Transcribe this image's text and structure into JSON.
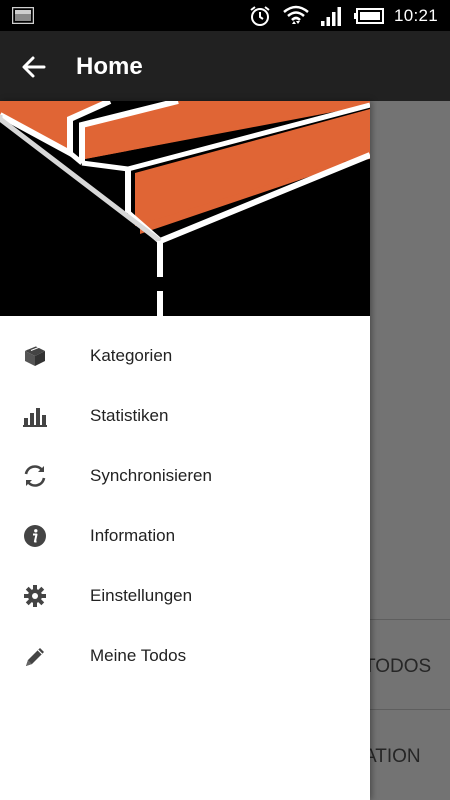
{
  "status_bar": {
    "time": "10:21",
    "icons": [
      "screenshot-notification-icon",
      "alarm-icon",
      "wifi-icon",
      "signal-icon",
      "battery-icon"
    ]
  },
  "app_bar": {
    "title": "Home",
    "back_icon": "arrow-left-icon"
  },
  "drawer": {
    "header_colors": {
      "orange": "#e06535",
      "background": "#000000",
      "lines": "#ffffff"
    },
    "items": [
      {
        "label": "Kategorien",
        "icon": "box-icon"
      },
      {
        "label": "Statistiken",
        "icon": "bar-chart-icon"
      },
      {
        "label": "Synchronisieren",
        "icon": "sync-icon"
      },
      {
        "label": "Information",
        "icon": "info-icon"
      },
      {
        "label": "Einstellungen",
        "icon": "gear-icon"
      },
      {
        "label": "Meine Todos",
        "icon": "pencil-icon"
      }
    ]
  },
  "background": {
    "items": [
      {
        "label": "TODOS"
      },
      {
        "label": "ATION"
      }
    ]
  }
}
